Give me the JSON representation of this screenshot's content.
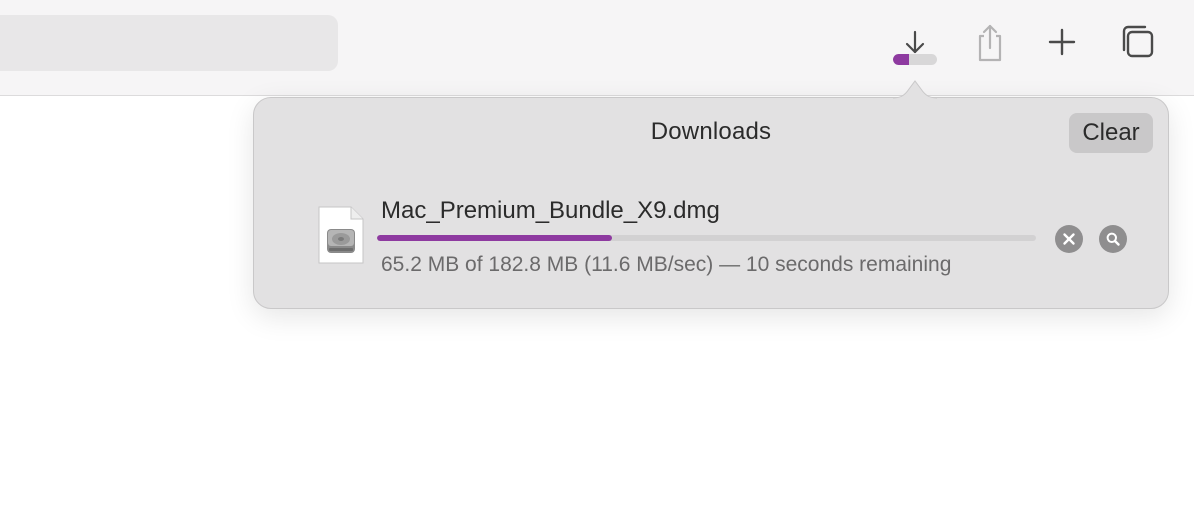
{
  "toolbar": {
    "download_progress_fraction": 0.357,
    "accent_color": "#8e3aa0",
    "icons": [
      "download-arrow-icon",
      "share-icon",
      "plus-icon",
      "tabs-overview-icon"
    ]
  },
  "downloads": {
    "title": "Downloads",
    "clear_label": "Clear",
    "items": [
      {
        "file_name": "Mac_Premium_Bundle_X9.dmg",
        "status": "65.2 MB of 182.8 MB (11.6 MB/sec) — 10 seconds remaining",
        "progress_fraction": 0.3567,
        "icon": "disk-image-file-icon",
        "actions": [
          "cancel-icon",
          "magnifier-icon"
        ]
      }
    ]
  }
}
